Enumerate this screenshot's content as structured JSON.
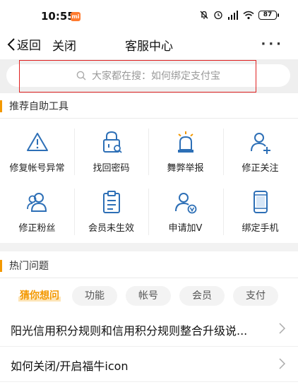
{
  "status_bar": {
    "time": "10:55",
    "mi_badge": "mi",
    "battery": "87"
  },
  "nav": {
    "back_label": "返回",
    "close_label": "关闭",
    "title": "客服中心",
    "more_label": "···"
  },
  "search": {
    "placeholder": "大家都在搜：如何绑定支付宝"
  },
  "tools_section": {
    "title": "推荐自助工具",
    "items": [
      {
        "label": "修复帐号异常",
        "icon": "warning-triangle-icon"
      },
      {
        "label": "找回密码",
        "icon": "lock-search-icon"
      },
      {
        "label": "舞弊举报",
        "icon": "alarm-siren-icon"
      },
      {
        "label": "修正关注",
        "icon": "user-plus-icon"
      },
      {
        "label": "修正粉丝",
        "icon": "users-icon"
      },
      {
        "label": "会员未生效",
        "icon": "clipboard-icon"
      },
      {
        "label": "申请加V",
        "icon": "user-verified-icon"
      },
      {
        "label": "绑定手机",
        "icon": "phone-icon"
      }
    ]
  },
  "hot_section": {
    "title": "热门问题",
    "chips": [
      "猜你想问",
      "功能",
      "帐号",
      "会员",
      "支付"
    ],
    "questions": [
      "阳光信用积分规则和信用积分规则整合升级说...",
      "如何关闭/开启福牛icon"
    ]
  },
  "colors": {
    "accent": "#f39800",
    "icon_blue": "#2d6fb6",
    "highlight_border": "#e02020"
  }
}
